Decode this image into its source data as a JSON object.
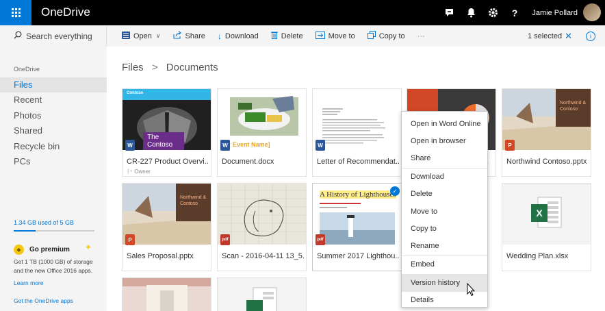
{
  "topbar": {
    "app_name": "OneDrive",
    "user_name": "Jamie Pollard",
    "icons": [
      "skype-icon",
      "bell-icon",
      "gear-icon",
      "help-icon"
    ]
  },
  "search": {
    "placeholder": "Search everything"
  },
  "commands": {
    "open": "Open",
    "share": "Share",
    "download": "Download",
    "delete": "Delete",
    "move_to": "Move to",
    "copy_to": "Copy to",
    "more": "···",
    "selected": "1 selected"
  },
  "nav": {
    "heading": "OneDrive",
    "items": [
      "Files",
      "Recent",
      "Photos",
      "Shared",
      "Recycle bin",
      "PCs"
    ],
    "storage": "1.34 GB used of 5 GB",
    "storage_used_fraction": 0.268,
    "premium_title": "Go premium",
    "premium_desc": "Get 1 TB (1000 GB) of storage and the new Office 2016 apps.",
    "learn_more": "Learn more",
    "get_apps": "Get the OneDrive apps"
  },
  "breadcrumb": {
    "root": "Files",
    "separator": ">",
    "current": "Documents"
  },
  "files": [
    {
      "name": "CR-227 Product Overvi...",
      "owner": "Owner",
      "type": "W",
      "thumb_text": "The Contoso",
      "brand": "Contoso"
    },
    {
      "name": "Document.docx",
      "type": "W",
      "thumb_text": "Event Name]"
    },
    {
      "name": "Letter of Recommendat...",
      "type": "W"
    },
    {
      "name": "...",
      "type": "P"
    },
    {
      "name": "Northwind Contoso.pptx",
      "type": "P",
      "thumb_text": "Northwind & Contoso"
    },
    {
      "name": "Sales Proposal.pptx",
      "type": "P",
      "thumb_text": "Northwind & Contoso"
    },
    {
      "name": "Scan - 2016-04-11 13_5...",
      "type": "pdf"
    },
    {
      "name": "Summer 2017 Lighthou...",
      "type": "pdf",
      "thumb_text": "A History of Lighthouses"
    },
    {
      "name": "",
      "type": "blank"
    },
    {
      "name": "Wedding Plan.xlsx",
      "type": "X"
    },
    {
      "name": "",
      "type": "image"
    },
    {
      "name": "",
      "type": "X"
    }
  ],
  "context_menu": {
    "items": [
      "Open in Word Online",
      "Open in browser",
      "Share",
      "Download",
      "Delete",
      "Move to",
      "Copy to",
      "Rename",
      "Embed",
      "Version history",
      "Details"
    ],
    "hovered": "Version history"
  },
  "colors": {
    "accent": "#0078d7",
    "word": "#2b579a",
    "powerpoint": "#d24726",
    "excel": "#217346"
  }
}
